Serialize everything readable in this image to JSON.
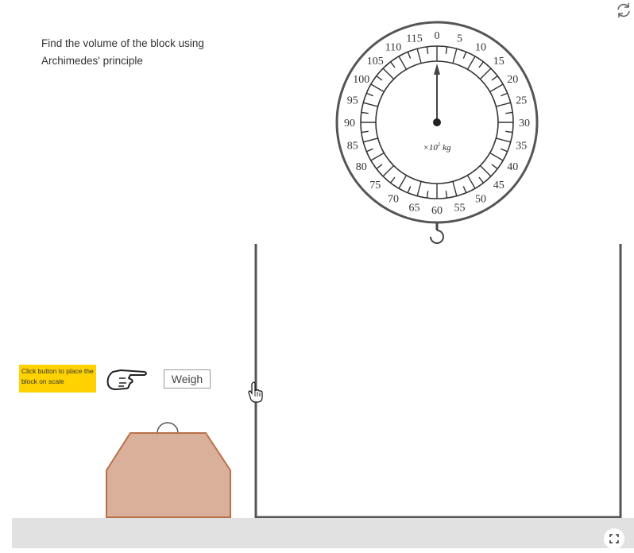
{
  "instruction": "Find the volume of the block using Archimedes' principle",
  "hint": "Click button to place the block on scale",
  "weigh_button_label": "Weigh",
  "scale": {
    "dial_labels": [
      "0",
      "5",
      "10",
      "15",
      "20",
      "25",
      "30",
      "35",
      "40",
      "45",
      "50",
      "55",
      "60",
      "65",
      "70",
      "75",
      "80",
      "85",
      "90",
      "95",
      "100",
      "105",
      "110",
      "115"
    ],
    "unit_prefix": "×10",
    "unit_exponent": "1",
    "unit_suffix": "kg",
    "reading": 0
  },
  "icons": {
    "reset": "reset-icon",
    "pointer": "pointing-hand-icon",
    "cursor": "hand-cursor-icon",
    "fullscreen": "fullscreen-icon"
  },
  "colors": {
    "hint_bg": "#ffd200",
    "block_fill": "#d9b19b",
    "block_stroke": "#b8704a",
    "floor": "#e1e1e1",
    "tank": "#555555"
  }
}
